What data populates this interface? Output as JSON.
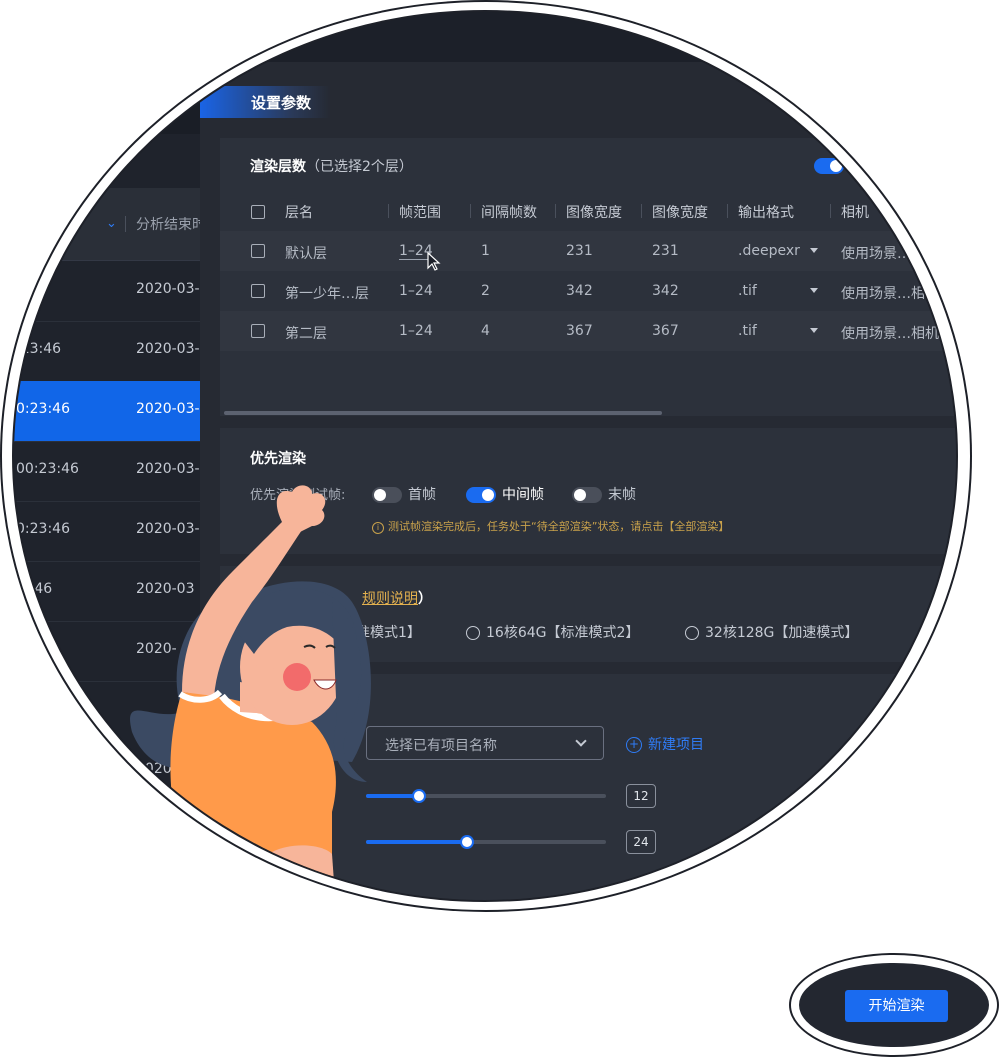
{
  "left_table": {
    "header_label": "分析结束时",
    "rows": [
      {
        "time": ":46",
        "date": "2020-03-"
      },
      {
        "time": ":23:46",
        "date": "2020-03-"
      },
      {
        "time": "0:23:46",
        "date": "2020-03-",
        "selected": true
      },
      {
        "time": "00:23:46",
        "date": "2020-03-"
      },
      {
        "time": "0:23:46",
        "date": "2020-03-"
      },
      {
        "time": ":3:46",
        "date": "2020-03"
      },
      {
        "time": "6",
        "date": "2020-"
      },
      {
        "time": "",
        "date": "2020-0"
      }
    ]
  },
  "main": {
    "title": "设置参数"
  },
  "layers": {
    "title": "渲染层数",
    "subtitle": "（已选择2个层）",
    "toggle_on": true,
    "columns": [
      "层名",
      "帧范围",
      "间隔帧数",
      "图像宽度",
      "图像宽度",
      "输出格式",
      "相机"
    ],
    "rows": [
      {
        "name": "默认层",
        "range": "1–24",
        "interval": "1",
        "w1": "231",
        "w2": "231",
        "format": ".deepexr",
        "camera": "使用场景…"
      },
      {
        "name": "第一少年…层",
        "range": "1–24",
        "interval": "2",
        "w1": "342",
        "w2": "342",
        "format": ".tif",
        "camera": "使用场景…相"
      },
      {
        "name": "第二层",
        "range": "1–24",
        "interval": "4",
        "w1": "367",
        "w2": "367",
        "format": ".tif",
        "camera": "使用场景…相机"
      }
    ]
  },
  "priority": {
    "title": "优先渲染",
    "label": "优先渲染测试帧:",
    "options": [
      {
        "label": "首帧",
        "on": false
      },
      {
        "label": "中间帧",
        "on": true
      },
      {
        "label": "末帧",
        "on": false
      }
    ],
    "tip": "测试帧渲染完成后，任务处于“待全部渲染”状态，请点击【全部渲染】"
  },
  "mode": {
    "title_prefix": "渲染",
    "link": "规则说明",
    "title_suffix": "）",
    "options": [
      "标准模式1】",
      "16核64G【标准模式2】",
      "32核128G【加速模式】"
    ]
  },
  "project": {
    "select_placeholder": "选择已有项目名称",
    "new_project": "新建项目",
    "slider1_value": "12",
    "slider1_fraction": 0.22,
    "slider2_value": "24",
    "slider2_fraction": 0.42,
    "slider1_label_tail": ")",
    "slider2_label_tail": ")"
  },
  "start_button": "开始渲染",
  "colors": {
    "accent": "#1a6bf0",
    "background": "#262a33",
    "card": "#2c313b",
    "warning": "#c9a24b"
  }
}
